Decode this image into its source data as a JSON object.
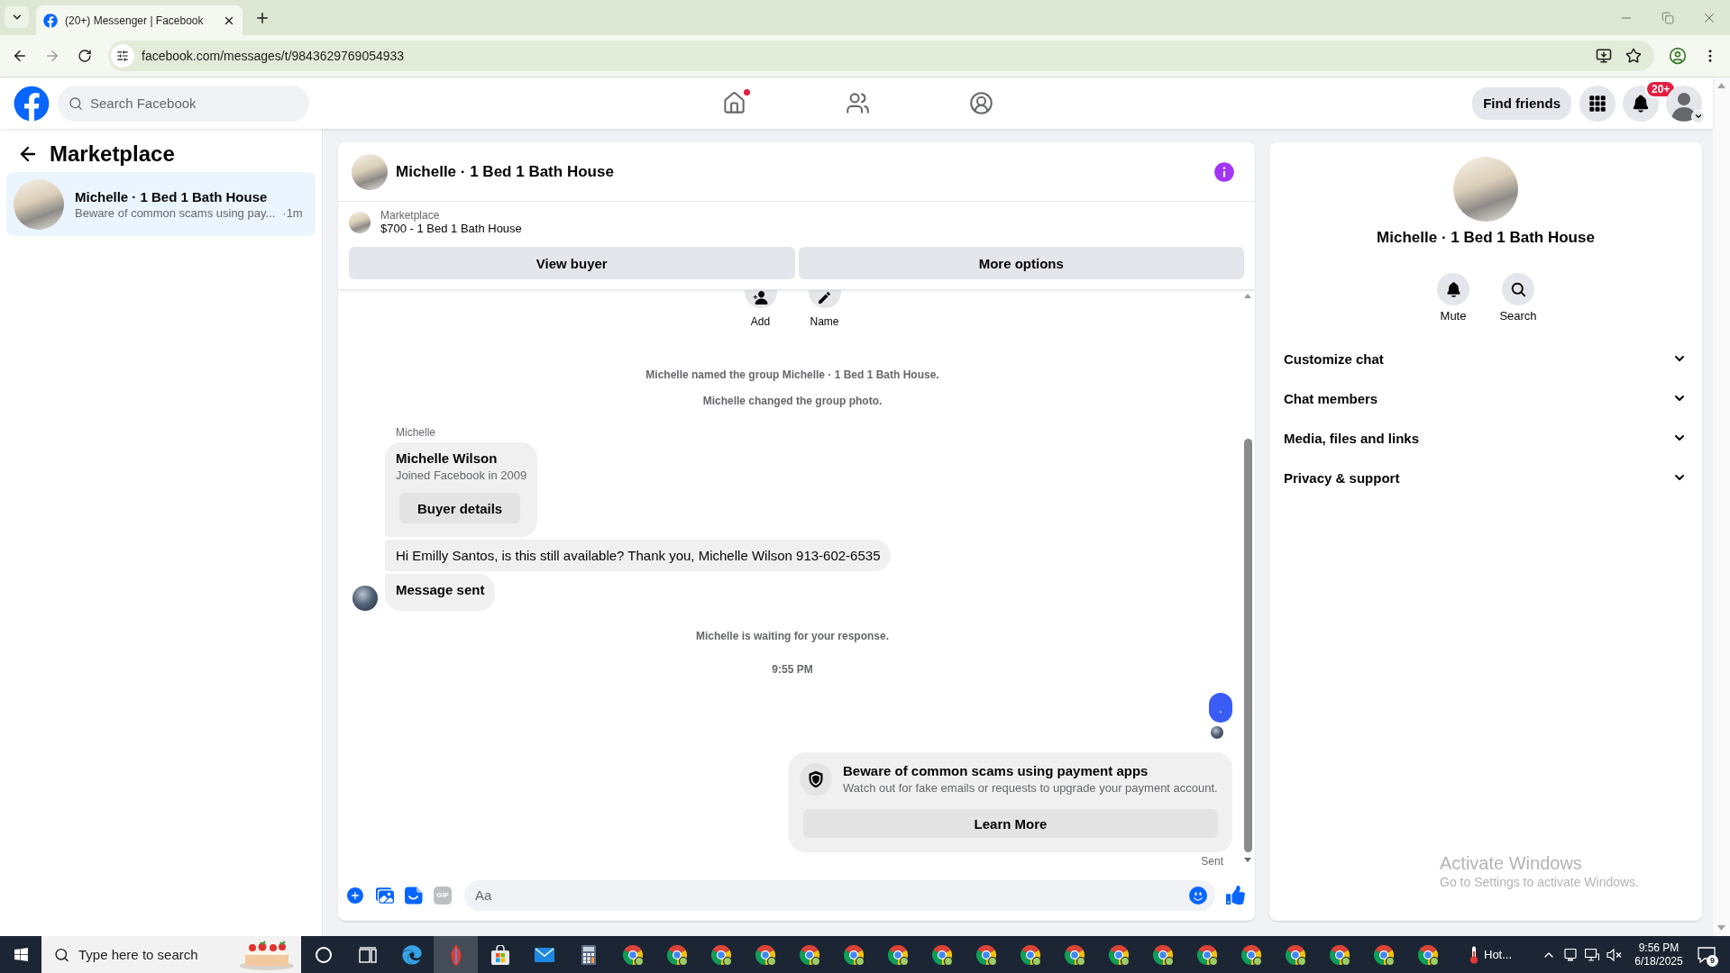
{
  "browser": {
    "tab_title": "(20+) Messenger | Facebook",
    "url": "facebook.com/messages/t/9843629769054933"
  },
  "header": {
    "search_placeholder": "Search Facebook",
    "nav": [
      {
        "kind": "home",
        "dot": true
      },
      {
        "kind": "friends",
        "dot": false
      },
      {
        "kind": "profile",
        "dot": false
      }
    ],
    "find_friends": "Find friends",
    "notification_badge": "20+"
  },
  "sidebar": {
    "title": "Marketplace",
    "conversations": [
      {
        "title": "Michelle · 1 Bed 1 Bath House",
        "preview": "Beware of common scams using pay...",
        "time": "·1m",
        "selected": true
      }
    ]
  },
  "chat": {
    "title": "Michelle · 1 Bed 1 Bath House",
    "listing": {
      "source": "Marketplace",
      "title": "$700 - 1 Bed 1 Bath House",
      "buttons": [
        "View buyer",
        "More options"
      ]
    },
    "actions": [
      {
        "kind": "add",
        "label": "Add"
      },
      {
        "kind": "name",
        "label": "Name"
      }
    ],
    "messages": [
      {
        "kind": "event",
        "text": "Michelle named the group Michelle · 1 Bed 1 Bath House."
      },
      {
        "kind": "event",
        "text": "Michelle changed the group photo."
      },
      {
        "kind": "sender",
        "text": "Michelle"
      },
      {
        "kind": "profile_card",
        "name": "Michelle Wilson",
        "detail": "Joined Facebook in 2009",
        "button": "Buyer details"
      },
      {
        "kind": "incoming",
        "text": "Hi Emilly Santos, is this still available? Thank you, Michelle Wilson 913-602-6535",
        "avatar": false,
        "bold": false
      },
      {
        "kind": "incoming",
        "text": "Message sent",
        "avatar": true,
        "bold": true
      },
      {
        "kind": "event",
        "text": "Michelle is waiting for your response."
      },
      {
        "kind": "time",
        "text": "9:55 PM"
      },
      {
        "kind": "outgoing",
        "text": "."
      },
      {
        "kind": "seen"
      },
      {
        "kind": "notice",
        "title": "Beware of common scams using payment apps",
        "body": "Watch out for fake emails or requests to upgrade your payment account.",
        "button": "Learn More"
      },
      {
        "kind": "status",
        "text": "Sent"
      }
    ],
    "composer": {
      "placeholder": "Aa",
      "gif": "GIF"
    }
  },
  "details": {
    "name": "Michelle · 1 Bed 1 Bath House",
    "actions": [
      {
        "kind": "mute",
        "label": "Mute"
      },
      {
        "kind": "search",
        "label": "Search"
      }
    ],
    "sections": [
      {
        "label": "Customize chat",
        "expanded": false
      },
      {
        "label": "Chat members",
        "expanded": false
      },
      {
        "label": "Media, files and links",
        "expanded": false
      },
      {
        "label": "Privacy & support",
        "expanded": false
      }
    ]
  },
  "windows_notice": {
    "title": "Activate Windows",
    "subtitle": "Go to Settings to activate Windows."
  },
  "taskbar": {
    "search_placeholder": "Type here to search",
    "apps": [
      {
        "kind": "ring",
        "active": false
      },
      {
        "kind": "task_view",
        "active": false
      },
      {
        "kind": "edge",
        "active": false
      },
      {
        "kind": "flame",
        "active": true
      },
      {
        "kind": "store",
        "active": false
      },
      {
        "kind": "mail",
        "active": false
      },
      {
        "kind": "calculator",
        "active": false
      },
      {
        "kind": "chrome",
        "active": false
      },
      {
        "kind": "chrome",
        "active": false
      },
      {
        "kind": "chrome",
        "active": false
      },
      {
        "kind": "chrome",
        "active": false
      },
      {
        "kind": "chrome",
        "active": false
      },
      {
        "kind": "chrome",
        "active": false
      },
      {
        "kind": "chrome",
        "active": false
      },
      {
        "kind": "chrome",
        "active": false
      },
      {
        "kind": "chrome",
        "active": false
      },
      {
        "kind": "chrome",
        "active": false
      },
      {
        "kind": "chrome",
        "active": false
      },
      {
        "kind": "chrome",
        "active": false
      },
      {
        "kind": "chrome",
        "active": false
      },
      {
        "kind": "chrome",
        "active": false
      },
      {
        "kind": "chrome",
        "active": false
      },
      {
        "kind": "chrome",
        "active": false
      },
      {
        "kind": "chrome",
        "active": false
      },
      {
        "kind": "chrome",
        "active": false
      },
      {
        "kind": "chrome",
        "active": false
      }
    ],
    "weather": "Hot...",
    "time": "9:56 PM",
    "date": "6/18/2025",
    "notification_count": "9"
  }
}
